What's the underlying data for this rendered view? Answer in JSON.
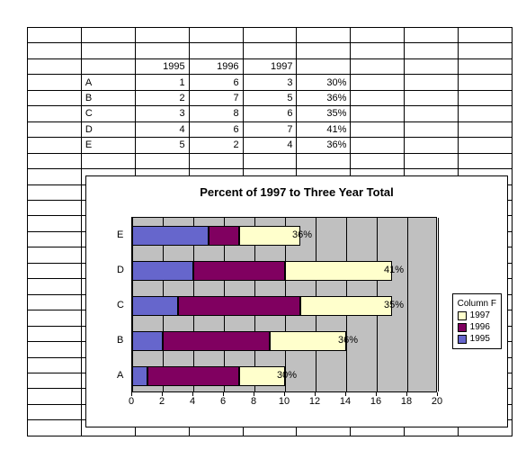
{
  "table": {
    "headers": [
      "1995",
      "1996",
      "1997"
    ],
    "rows": [
      {
        "label": "A",
        "v1995": "1",
        "v1996": "6",
        "v1997": "3",
        "pct": "30%"
      },
      {
        "label": "B",
        "v1995": "2",
        "v1996": "7",
        "v1997": "5",
        "pct": "36%"
      },
      {
        "label": "C",
        "v1995": "3",
        "v1996": "8",
        "v1997": "6",
        "pct": "35%"
      },
      {
        "label": "D",
        "v1995": "4",
        "v1996": "6",
        "v1997": "7",
        "pct": "41%"
      },
      {
        "label": "E",
        "v1995": "5",
        "v1996": "2",
        "v1997": "4",
        "pct": "36%"
      }
    ]
  },
  "chart": {
    "title": "Percent of 1997 to Three Year Total",
    "legend_title": "Column F",
    "legend": [
      "1997",
      "1996",
      "1995"
    ],
    "xticks": [
      "0",
      "2",
      "4",
      "6",
      "8",
      "10",
      "12",
      "14",
      "16",
      "18",
      "20"
    ]
  },
  "chart_data": {
    "type": "bar",
    "orientation": "horizontal",
    "stacked": true,
    "title": "Percent of 1997 to Three Year Total",
    "xlabel": "",
    "ylabel": "",
    "xlim": [
      0,
      20
    ],
    "categories": [
      "A",
      "B",
      "C",
      "D",
      "E"
    ],
    "series": [
      {
        "name": "1995",
        "values": [
          1,
          2,
          3,
          4,
          5
        ],
        "color": "#6666cc"
      },
      {
        "name": "1996",
        "values": [
          6,
          7,
          8,
          6,
          2
        ],
        "color": "#800060"
      },
      {
        "name": "1997",
        "values": [
          3,
          5,
          6,
          7,
          4
        ],
        "color": "#ffffcc"
      }
    ],
    "data_labels": [
      "30%",
      "36%",
      "35%",
      "41%",
      "36%"
    ],
    "legend": {
      "title": "Column F",
      "position": "right"
    }
  }
}
